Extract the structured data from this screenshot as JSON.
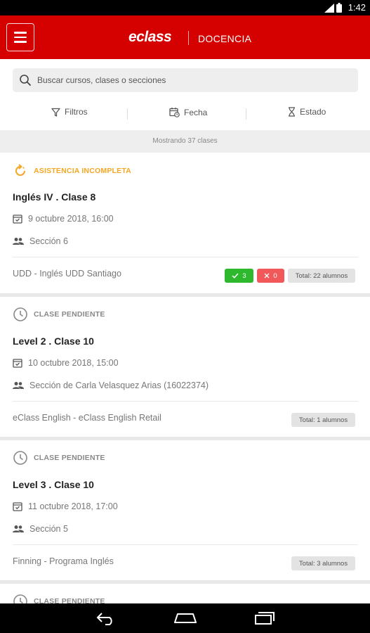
{
  "status_bar": {
    "time": "1:42"
  },
  "app_bar": {
    "logo": "eclass",
    "section": "DOCENCIA"
  },
  "search": {
    "placeholder": "Buscar cursos, clases o secciones"
  },
  "filters": {
    "filters_label": "Filtros",
    "date_label": "Fecha",
    "state_label": "Estado"
  },
  "count": {
    "label": "Mostrando 37 clases"
  },
  "cards": [
    {
      "status": "ASISTENCIA INCOMPLETA",
      "status_color": "#f5a623",
      "title": "Inglés IV . Clase 8",
      "date": "9 octubre 2018, 16:00",
      "section": "Sección 6",
      "org": "UDD - Inglés UDD Santiago",
      "present": "3",
      "absent": "0",
      "total": "Total: 22 alumnos"
    },
    {
      "status": "CLASE PENDIENTE",
      "status_color": "#888888",
      "title": "Level 2 . Clase 10",
      "date": "10 octubre 2018, 15:00",
      "section": "Sección de Carla Velasquez Arias (16022374)",
      "org": "eClass English - eClass English Retail",
      "total": "Total: 1 alumnos"
    },
    {
      "status": "CLASE PENDIENTE",
      "status_color": "#888888",
      "title": "Level 3 . Clase 10",
      "date": "11 octubre 2018, 17:00",
      "section": "Sección 5",
      "org": "Finning - Programa Inglés",
      "total": "Total: 3 alumnos"
    },
    {
      "status": "CLASE PENDIENTE",
      "status_color": "#888888"
    }
  ],
  "colors": {
    "brand": "#d50000",
    "success": "#2eb82e",
    "danger": "#f0585a",
    "warning": "#f5a623"
  }
}
